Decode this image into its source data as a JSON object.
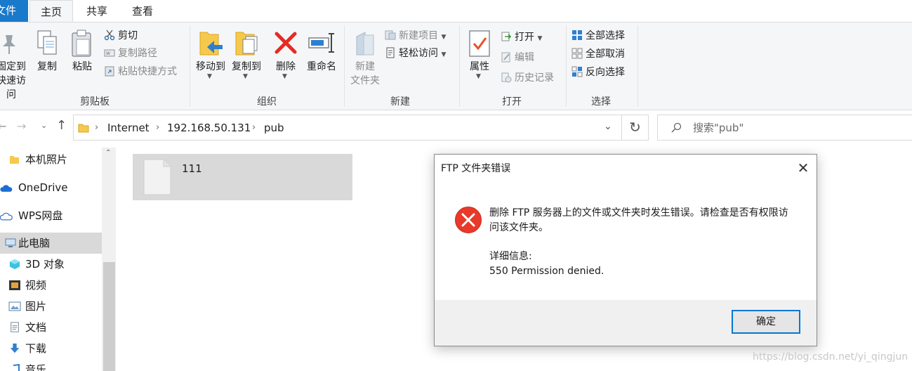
{
  "tabs": {
    "file": "文件",
    "home": "主页",
    "share": "共享",
    "view": "查看"
  },
  "ribbon": {
    "clipboard": {
      "pin_line1": "固定到",
      "pin_line2": "快速访问",
      "copy": "复制",
      "paste": "粘贴",
      "cut": "剪切",
      "copy_path": "复制路径",
      "paste_shortcut": "粘贴快捷方式",
      "group_label": "剪贴板"
    },
    "organize": {
      "move_to": "移动到",
      "copy_to": "复制到",
      "delete": "删除",
      "rename": "重命名",
      "group_label": "组织"
    },
    "new": {
      "new_folder_line1": "新建",
      "new_folder_line2": "文件夹",
      "new_item": "新建项目",
      "easy_access": "轻松访问",
      "group_label": "新建"
    },
    "open": {
      "properties": "属性",
      "open": "打开",
      "edit": "编辑",
      "history": "历史记录",
      "group_label": "打开"
    },
    "select": {
      "select_all": "全部选择",
      "select_none": "全部取消",
      "invert": "反向选择",
      "group_label": "选择"
    }
  },
  "address": {
    "crumbs": [
      "Internet",
      "192.168.50.131",
      "pub"
    ],
    "search_placeholder": "搜索\"pub\""
  },
  "nav": {
    "items": [
      {
        "label": "本机照片"
      },
      {
        "label": "OneDrive"
      },
      {
        "label": "WPS网盘"
      },
      {
        "label": "此电脑"
      },
      {
        "label": "3D 对象"
      },
      {
        "label": "视频"
      },
      {
        "label": "图片"
      },
      {
        "label": "文档"
      },
      {
        "label": "下载"
      },
      {
        "label": "音乐"
      }
    ]
  },
  "content": {
    "files": [
      {
        "name": "111"
      }
    ]
  },
  "dialog": {
    "title": "FTP 文件夹错误",
    "message_line1": "删除 FTP 服务器上的文件或文件夹时发生错误。请检查是否有权限访",
    "message_line2": "问该文件夹。",
    "details_label": "详细信息:",
    "details_value": "550 Permission denied.",
    "ok": "确定"
  },
  "watermark": "https://blog.csdn.net/yi_qingjun",
  "colors": {
    "accent": "#1979ca",
    "error_red": "#e8392a",
    "folder_yellow": "#f6c94c",
    "selection_gray": "#d9d9d9"
  }
}
